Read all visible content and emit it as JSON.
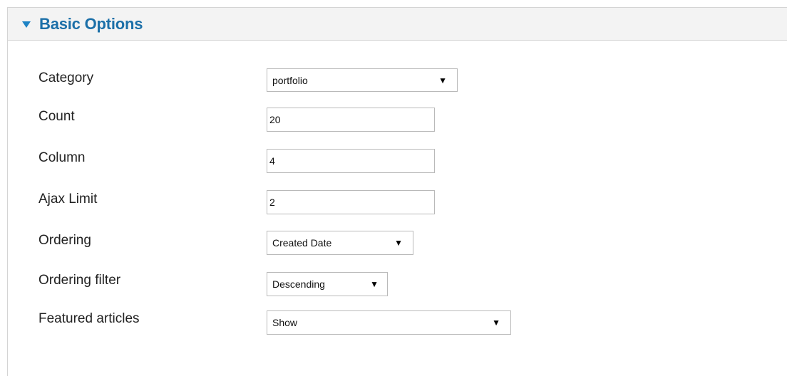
{
  "section": {
    "title": "Basic Options",
    "toggle_icon": "caret-down-icon"
  },
  "fields": {
    "category": {
      "label": "Category",
      "value": "portfolio",
      "type": "select"
    },
    "count": {
      "label": "Count",
      "value": "20",
      "type": "text"
    },
    "column": {
      "label": "Column",
      "value": "4",
      "type": "text"
    },
    "ajax_limit": {
      "label": "Ajax Limit",
      "value": "2",
      "type": "text"
    },
    "ordering": {
      "label": "Ordering",
      "value": "Created Date",
      "type": "select"
    },
    "ordering_filter": {
      "label": "Ordering filter",
      "value": "Descending",
      "type": "select"
    },
    "featured_articles": {
      "label": "Featured articles",
      "value": "Show",
      "type": "select"
    }
  },
  "colors": {
    "header_title": "#1b6fa8",
    "toggle_icon": "#1e83c4",
    "header_bg": "#f3f3f3",
    "border": "#d4d4d4"
  }
}
